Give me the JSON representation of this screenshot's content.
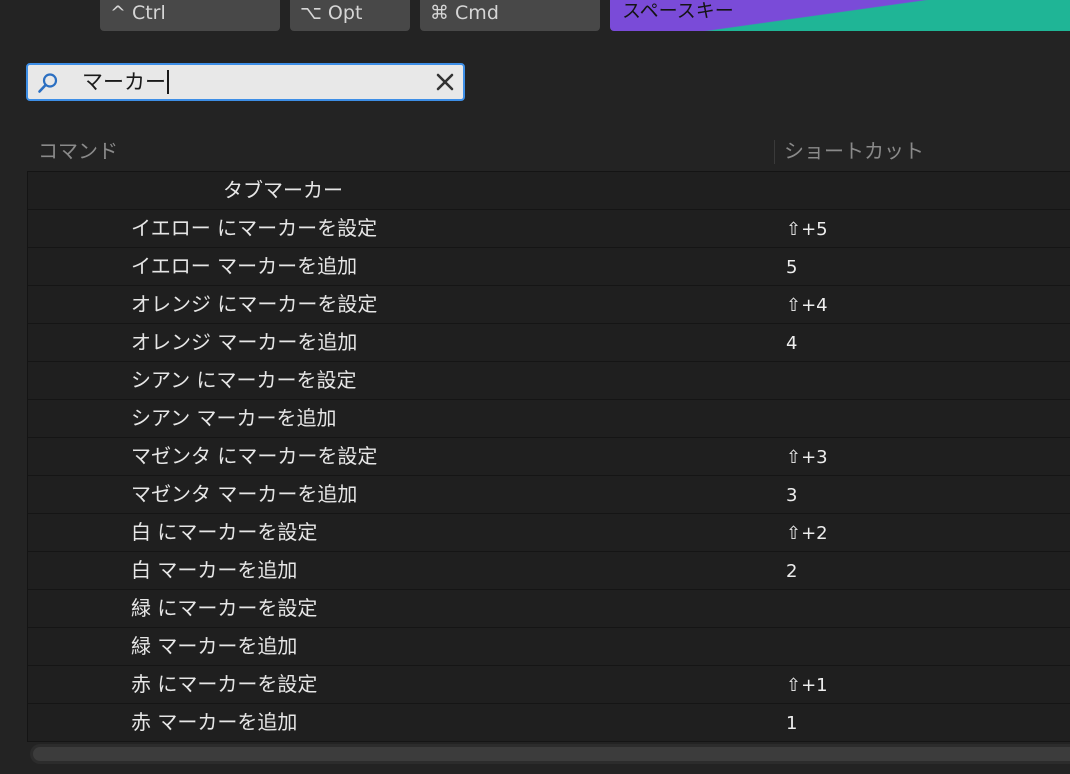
{
  "modifier_keys": {
    "ctrl": "^ Ctrl",
    "opt": "⌥ Opt",
    "cmd": "⌘ Cmd",
    "space": "スペースキー"
  },
  "search": {
    "value": "マーカー",
    "icon": "search-icon",
    "clear_icon": "close-icon",
    "accent_color": "#3d8ee6"
  },
  "columns": {
    "command": "コマンド",
    "shortcut": "ショートカット"
  },
  "rows": [
    {
      "command": "タブマーカー",
      "shortcut": "",
      "is_header": true
    },
    {
      "command": "イエロー にマーカーを設定",
      "shortcut": "⇧+5"
    },
    {
      "command": "イエロー マーカーを追加",
      "shortcut": "5"
    },
    {
      "command": "オレンジ にマーカーを設定",
      "shortcut": "⇧+4"
    },
    {
      "command": "オレンジ マーカーを追加",
      "shortcut": "4"
    },
    {
      "command": "シアン にマーカーを設定",
      "shortcut": ""
    },
    {
      "command": "シアン マーカーを追加",
      "shortcut": ""
    },
    {
      "command": "マゼンタ にマーカーを設定",
      "shortcut": "⇧+3"
    },
    {
      "command": "マゼンタ マーカーを追加",
      "shortcut": "3"
    },
    {
      "command": "白 にマーカーを設定",
      "shortcut": "⇧+2"
    },
    {
      "command": "白 マーカーを追加",
      "shortcut": "2"
    },
    {
      "command": "緑 にマーカーを設定",
      "shortcut": ""
    },
    {
      "command": "緑 マーカーを追加",
      "shortcut": ""
    },
    {
      "command": "赤 にマーカーを設定",
      "shortcut": "⇧+1"
    },
    {
      "command": "赤 マーカーを追加",
      "shortcut": "1"
    }
  ]
}
